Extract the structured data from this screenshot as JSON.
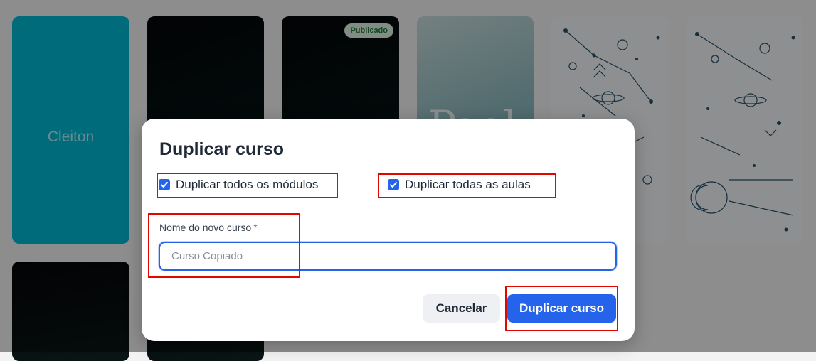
{
  "background_cards": {
    "card1_label": "Cleiton",
    "card3_badge": "Publicado",
    "card4_text": "Pael"
  },
  "modal": {
    "title": "Duplicar curso",
    "options": {
      "duplicate_modules": {
        "label": "Duplicar todos os módulos",
        "checked": true
      },
      "duplicate_lessons": {
        "label": "Duplicar todas as aulas",
        "checked": true
      }
    },
    "name_field": {
      "label": "Nome do novo curso",
      "required_mark": "*",
      "placeholder": "Curso Copiado",
      "value": ""
    },
    "cancel_label": "Cancelar",
    "confirm_label": "Duplicar curso"
  },
  "colors": {
    "primary": "#2563eb",
    "highlight": "#e10600",
    "badge_bg": "#dff3e4",
    "badge_text": "#1f7a3a"
  },
  "icons": [
    "check-icon"
  ]
}
